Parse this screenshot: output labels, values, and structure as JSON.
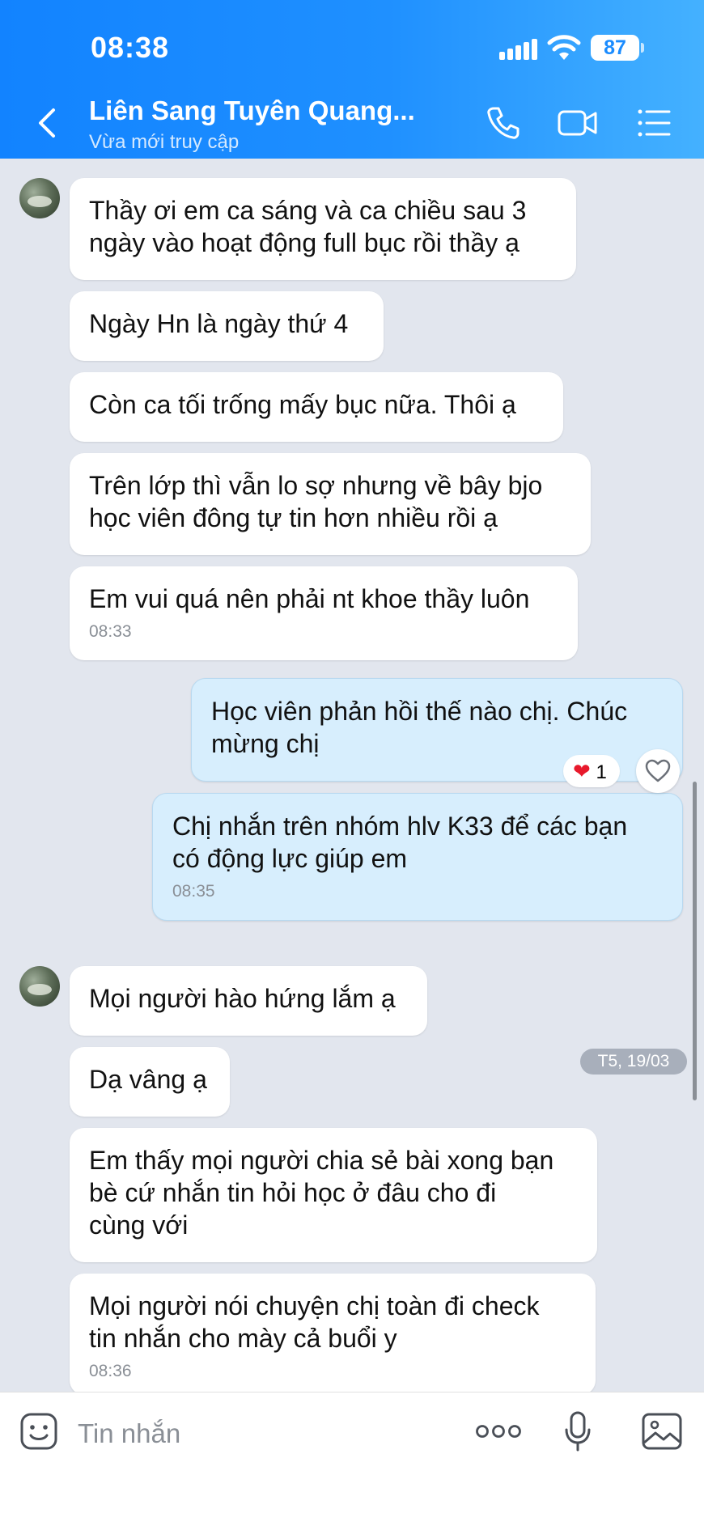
{
  "status_bar": {
    "time": "08:38",
    "battery": "87"
  },
  "header": {
    "contact_name": "Liên Sang Tuyên Quang...",
    "contact_status": "Vừa mới truy cập"
  },
  "messages": [
    {
      "dir": "in",
      "text": "Thầy ơi em ca sáng và ca chiều sau 3\nngày vào hoạt động full bục rồi thầy ạ",
      "time": ""
    },
    {
      "dir": "in",
      "text": "Ngày Hn là ngày thứ 4",
      "time": ""
    },
    {
      "dir": "in",
      "text": "Còn ca tối trống mấy bục nữa. Thôi ạ",
      "time": ""
    },
    {
      "dir": "in",
      "text": "Trên lớp thì vẫn lo sợ nhưng về bây bjo\nhọc viên đông tự tin hơn nhiều rồi ạ",
      "time": ""
    },
    {
      "dir": "in",
      "text": "Em vui quá nên phải nt khoe thầy luôn",
      "time": "08:33"
    },
    {
      "dir": "out",
      "text": "Học viên phản hồi thế nào chị. Chúc\nmừng chị",
      "time": ""
    },
    {
      "dir": "out",
      "text": "Chị nhắn trên nhóm hlv K33 để các bạn\ncó động lực giúp em",
      "time": "08:35"
    },
    {
      "dir": "in",
      "text": "Mọi người hào hứng lắm ạ",
      "time": ""
    },
    {
      "dir": "in",
      "text": "Dạ vâng ạ",
      "time": ""
    },
    {
      "dir": "in",
      "text": "Em thấy mọi người chia sẻ bài xong bạn\nbè cứ nhắn tin hỏi học ở đâu cho đi\ncùng với",
      "time": ""
    },
    {
      "dir": "in",
      "text": "Mọi người nói chuyện chị toàn đi check\ntin nhắn cho mày cả buổi y",
      "time": "08:36"
    }
  ],
  "reaction": {
    "emoji": "❤",
    "count": "1"
  },
  "date_separator": "T5, 19/03",
  "input": {
    "placeholder": "Tin nhắn"
  },
  "colors": {
    "header_start": "#1283ff",
    "header_end": "#44b1ff",
    "incoming_bubble": "#ffffff",
    "outgoing_bubble": "#d7eefd",
    "background": "#e2e6ee"
  },
  "icons": [
    "back-icon",
    "phone-icon",
    "video-call-icon",
    "menu-icon",
    "sticker-icon",
    "more-icon",
    "microphone-icon",
    "image-icon",
    "heart-outline-icon"
  ]
}
